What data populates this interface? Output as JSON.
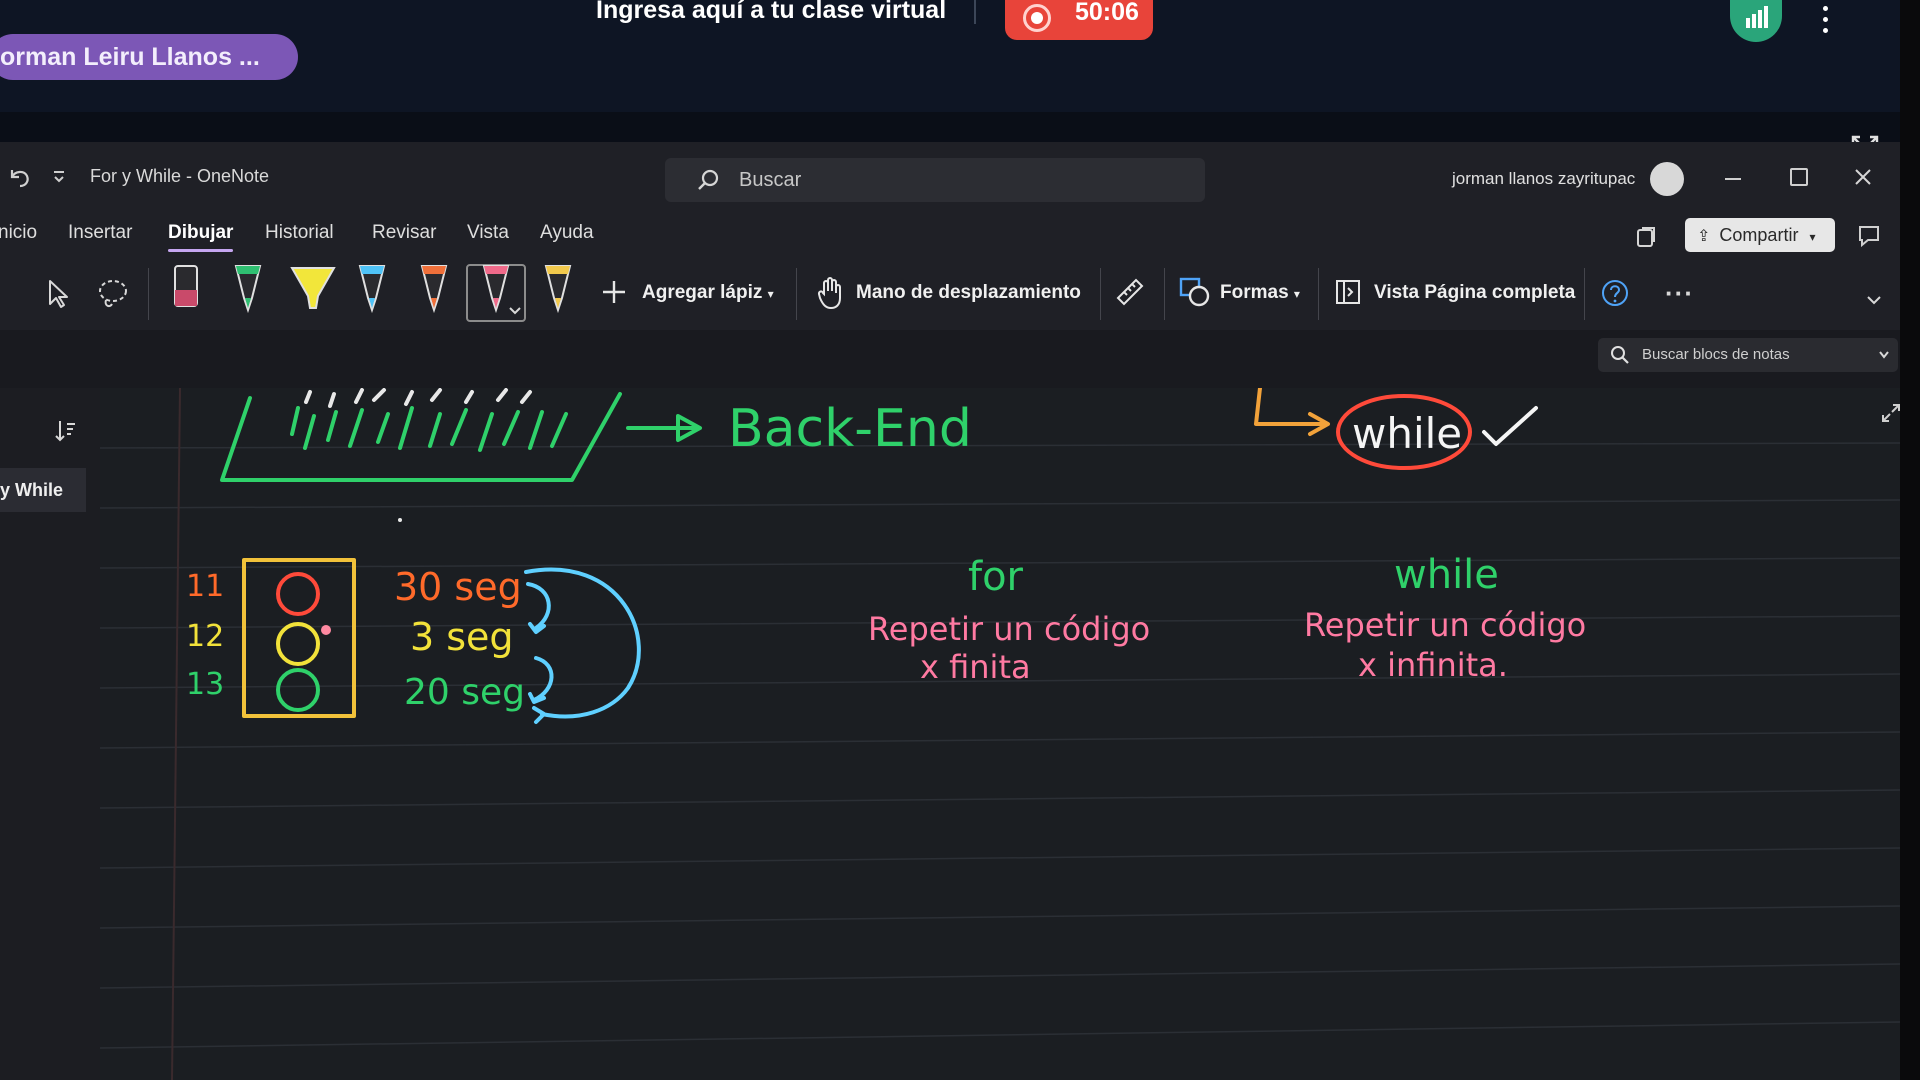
{
  "meeting": {
    "presenter": "orman Leiru Llanos ...",
    "banner": "Ingresa aquí a tu clase virtual",
    "recording_time": "50:06"
  },
  "titlebar": {
    "doc_title": "For y While  -  OneNote",
    "search_placeholder": "Buscar",
    "user_name": "jorman llanos zayritupac"
  },
  "ribbon": {
    "tabs": [
      "nicio",
      "Insertar",
      "Dibujar",
      "Historial",
      "Revisar",
      "Vista",
      "Ayuda"
    ],
    "active_tab": "Dibujar",
    "share_label": "Compartir",
    "add_pen_label": "Agregar lápiz",
    "pan_label": "Mano de desplazamiento",
    "shapes_label": "Formas",
    "full_page_label": "Vista Página completa",
    "more_label": "···",
    "pen_colors": [
      "#c94a6a",
      "#2fbf71",
      "#f2e63a",
      "#4fc3f7",
      "#f0703a",
      "#f06a8a",
      "#f2c94c"
    ]
  },
  "nav": {
    "notebook_search_placeholder": "Buscar blocs de notas",
    "page_label": "y While"
  },
  "canvas": {
    "backend_label": "Back-End",
    "while_circled": "while",
    "row_numbers": [
      "11",
      "12",
      "13"
    ],
    "timings": [
      "30 seg",
      "3 seg",
      "20 seg"
    ],
    "for_heading": "for",
    "for_line1": "Repetir un código",
    "for_line2": "x finita",
    "while_heading": "while",
    "while_line1": "Repetir un código",
    "while_line2": "x infinita.",
    "colors": {
      "green": "#2fd16a",
      "red": "#ff4a3a",
      "orange": "#ff7a2a",
      "yellow": "#f2e23a",
      "cyan": "#5fd0ff",
      "pink": "#ff7aa2",
      "white_dot": "#e8e8e8"
    }
  }
}
